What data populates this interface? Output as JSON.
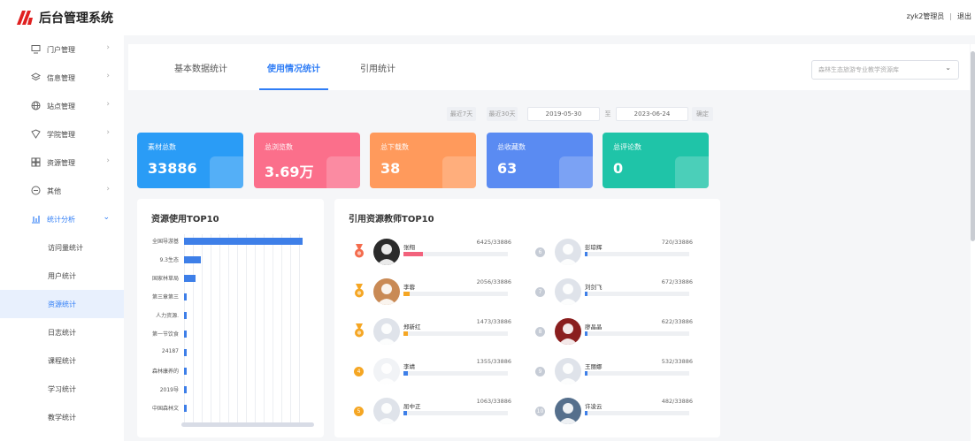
{
  "header": {
    "app_title": "后台管理系统",
    "user": "zyk2管理员",
    "logout": "退出"
  },
  "sidebar": {
    "items": [
      {
        "label": "门户管理",
        "icon": "monitor-icon"
      },
      {
        "label": "信息管理",
        "icon": "layers-icon"
      },
      {
        "label": "站点管理",
        "icon": "globe-icon"
      },
      {
        "label": "学院管理",
        "icon": "shield-icon"
      },
      {
        "label": "资源管理",
        "icon": "grid-icon"
      },
      {
        "label": "其他",
        "icon": "minus-circle-icon"
      },
      {
        "label": "统计分析",
        "icon": "bar-chart-icon"
      }
    ],
    "sub_items": [
      "访问量统计",
      "用户统计",
      "资源统计",
      "日志统计",
      "课程统计",
      "学习统计",
      "教学统计"
    ]
  },
  "tabs": [
    "基本数据统计",
    "使用情况统计",
    "引用统计"
  ],
  "library_select": {
    "value": "森林生态旅游专业教学资源库"
  },
  "filter": {
    "last7": "最近7天",
    "last30": "最近30天",
    "start_date": "2019-05-30",
    "to": "至",
    "end_date": "2023-06-24",
    "confirm": "确定"
  },
  "stats": [
    {
      "title": "素材总数",
      "value": "33886",
      "color": "#2a9cf6"
    },
    {
      "title": "总浏览数",
      "value": "3.69万",
      "color": "#fb6f8b"
    },
    {
      "title": "总下载数",
      "value": "38",
      "color": "#ff9a5c"
    },
    {
      "title": "总收藏数",
      "value": "63",
      "color": "#5a8bf2"
    },
    {
      "title": "总评论数",
      "value": "0",
      "color": "#1fc4a8"
    }
  ],
  "resource_top": {
    "title": "资源使用TOP10",
    "items": [
      {
        "label": "全国导游基",
        "value": 1
      },
      {
        "label": "9.3生态",
        "value": 0.14
      },
      {
        "label": "国家林草局",
        "value": 0.1
      },
      {
        "label": "第三章第三",
        "value": 0.05
      },
      {
        "label": "人力资源.",
        "value": 0.05
      },
      {
        "label": "第一节饮食",
        "value": 0.05
      },
      {
        "label": "24187",
        "value": 0.05
      },
      {
        "label": "森林康养的",
        "value": 0.05
      },
      {
        "label": "2019导",
        "value": 0.05
      },
      {
        "label": "中国森林文",
        "value": 0.05
      }
    ]
  },
  "teacher_top": {
    "title": "引用资源教师TOP10",
    "items": [
      {
        "rank": "1",
        "name": "张翔",
        "count": "6425/33886",
        "ratio": 0.19,
        "color": "#f2627c"
      },
      {
        "rank": "2",
        "name": "李蓉",
        "count": "2056/33886",
        "ratio": 0.061,
        "color": "#f5a623"
      },
      {
        "rank": "3",
        "name": "郑新红",
        "count": "1473/33886",
        "ratio": 0.043,
        "color": "#f5a623"
      },
      {
        "rank": "4",
        "name": "李靖",
        "count": "1355/33886",
        "ratio": 0.04,
        "color": "#3e7fe8"
      },
      {
        "rank": "5",
        "name": "屈中正",
        "count": "1063/33886",
        "ratio": 0.031,
        "color": "#3e7fe8"
      },
      {
        "rank": "6",
        "name": "彭琼辉",
        "count": "720/33886",
        "ratio": 0.021,
        "color": "#3e7fe8"
      },
      {
        "rank": "7",
        "name": "刘剑飞",
        "count": "672/33886",
        "ratio": 0.02,
        "color": "#3e7fe8"
      },
      {
        "rank": "8",
        "name": "廖晶晶",
        "count": "622/33886",
        "ratio": 0.018,
        "color": "#3e7fe8"
      },
      {
        "rank": "9",
        "name": "王丽娜",
        "count": "532/33886",
        "ratio": 0.016,
        "color": "#3e7fe8"
      },
      {
        "rank": "10",
        "name": "许凌云",
        "count": "482/33886",
        "ratio": 0.014,
        "color": "#3e7fe8"
      }
    ]
  }
}
